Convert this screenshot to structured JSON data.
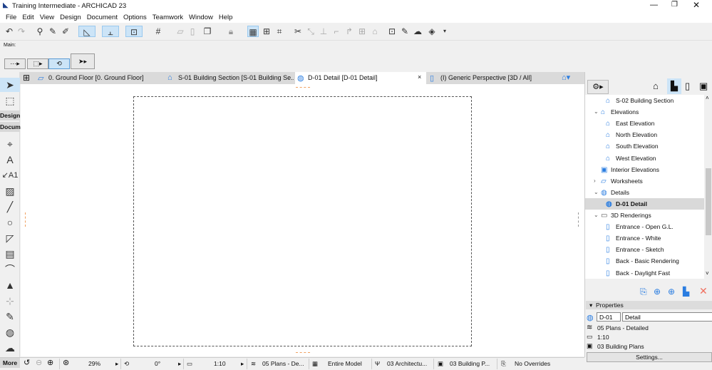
{
  "window": {
    "title": "Training Intermediate - ARCHICAD 23"
  },
  "menu": [
    "File",
    "Edit",
    "View",
    "Design",
    "Document",
    "Options",
    "Teamwork",
    "Window",
    "Help"
  ],
  "toolbox": {
    "main_label": "Main:",
    "design": "Design",
    "docum": "Docum",
    "more": "More"
  },
  "tabs": [
    {
      "label": "0. Ground Floor [0. Ground Floor]",
      "icon": "floor-plan-icon"
    },
    {
      "label": "S-01 Building Section [S-01 Building Se...",
      "icon": "section-icon"
    },
    {
      "label": "D-01 Detail [D-01 Detail]",
      "icon": "detail-icon",
      "active": true,
      "close": "×"
    },
    {
      "label": "(I) Generic Perspective [3D / All]",
      "icon": "3d-icon"
    }
  ],
  "navigator": {
    "items": [
      {
        "label": "S-02 Building Section",
        "level": 2
      },
      {
        "label": "Elevations",
        "level": 1,
        "expanded": true
      },
      {
        "label": "East Elevation",
        "level": 2
      },
      {
        "label": "North Elevation",
        "level": 2
      },
      {
        "label": "South Elevation",
        "level": 2
      },
      {
        "label": "West Elevation",
        "level": 2
      },
      {
        "label": "Interior Elevations",
        "level": 1
      },
      {
        "label": "Worksheets",
        "level": 1,
        "expanded": false
      },
      {
        "label": "Details",
        "level": 1,
        "expanded": true
      },
      {
        "label": "D-01 Detail",
        "level": 2,
        "selected": true
      },
      {
        "label": "3D Renderings",
        "level": 1,
        "expanded": true
      },
      {
        "label": "Entrance - Open G.L.",
        "level": 2
      },
      {
        "label": "Entrance - White",
        "level": 2
      },
      {
        "label": "Entrance - Sketch",
        "level": 2
      },
      {
        "label": "Back - Basic Rendering",
        "level": 2
      },
      {
        "label": "Back - Daylight Fast",
        "level": 2
      }
    ]
  },
  "properties": {
    "title": "Properties",
    "id": "D-01",
    "name": "Detail",
    "layer_combo": "05 Plans - Detailed",
    "scale": "1:10",
    "pen_set": "03 Building Plans",
    "settings": "Settings..."
  },
  "status": {
    "zoom": "29%",
    "angle": "0°",
    "scale": "1:10",
    "layers": "05 Plans - De...",
    "model": "Entire Model",
    "pen": "03 Architectu...",
    "display": "03 Building P...",
    "overrides": "No Overrides"
  },
  "colors": {
    "accent": "#2a7de1",
    "selection": "#cce4f7"
  }
}
